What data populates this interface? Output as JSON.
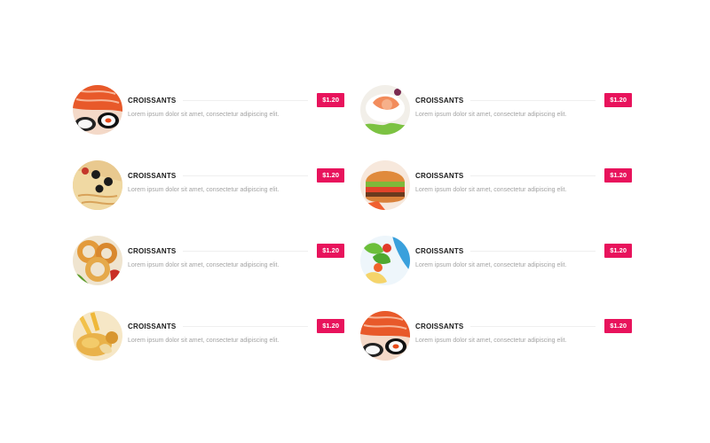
{
  "colors": {
    "accent": "#e8135c",
    "title": "#1a1a1a",
    "description": "#a3a3a3"
  },
  "menu": {
    "items": [
      {
        "name": "CROISSANTS",
        "price": "$1.20",
        "description": "Lorem ipsum dolor sit amet, consectetur adipiscing elit.",
        "image": "sushi-icon"
      },
      {
        "name": "CROISSANTS",
        "price": "$1.20",
        "description": "Lorem ipsum dolor sit amet, consectetur adipiscing elit.",
        "image": "shrimp-plate-icon"
      },
      {
        "name": "CROISSANTS",
        "price": "$1.20",
        "description": "Lorem ipsum dolor sit amet, consectetur adipiscing elit.",
        "image": "pizza-icon"
      },
      {
        "name": "CROISSANTS",
        "price": "$1.20",
        "description": "Lorem ipsum dolor sit amet, consectetur adipiscing elit.",
        "image": "burger-icon"
      },
      {
        "name": "CROISSANTS",
        "price": "$1.20",
        "description": "Lorem ipsum dolor sit amet, consectetur adipiscing elit.",
        "image": "onion-rings-icon"
      },
      {
        "name": "CROISSANTS",
        "price": "$1.20",
        "description": "Lorem ipsum dolor sit amet, consectetur adipiscing elit.",
        "image": "salad-icon"
      },
      {
        "name": "CROISSANTS",
        "price": "$1.20",
        "description": "Lorem ipsum dolor sit amet, consectetur adipiscing elit.",
        "image": "fried-food-icon"
      },
      {
        "name": "CROISSANTS",
        "price": "$1.20",
        "description": "Lorem ipsum dolor sit amet, consectetur adipiscing elit.",
        "image": "sushi-icon"
      }
    ]
  }
}
